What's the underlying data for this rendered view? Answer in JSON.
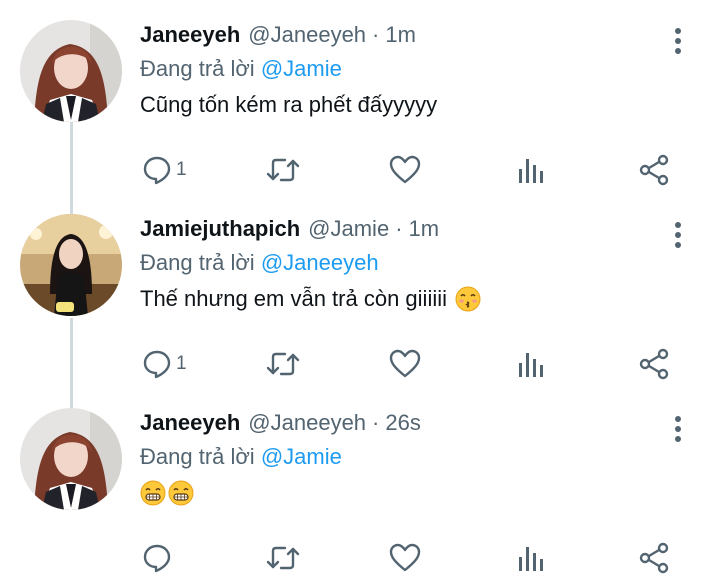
{
  "colors": {
    "accent": "#1d9bf0",
    "muted": "#536471",
    "text": "#0f1419",
    "thread_line": "#cfd9de"
  },
  "replying_prefix": "Đang trả lời",
  "tweets": [
    {
      "name": "Janeeyeh",
      "handle": "@Janeeyeh",
      "separator": "·",
      "time": "1m",
      "reply_to": "@Jamie",
      "text": "Cũng tốn kém ra phết đấyyyyy",
      "emojis": [],
      "reply_count": "1",
      "icons": [
        "reply-icon",
        "retweet-icon",
        "like-icon",
        "views-icon",
        "share-icon",
        "more-icon"
      ]
    },
    {
      "name": "Jamiejuthapich",
      "handle": "@Jamie",
      "separator": "·",
      "time": "1m",
      "reply_to": "@Janeeyeh",
      "text": "Thế nhưng em vẫn trả còn giiiiii",
      "emojis": [
        "kissing-face-emoji"
      ],
      "reply_count": "1",
      "icons": [
        "reply-icon",
        "retweet-icon",
        "like-icon",
        "views-icon",
        "share-icon",
        "more-icon"
      ]
    },
    {
      "name": "Janeeyeh",
      "handle": "@Janeeyeh",
      "separator": "·",
      "time": "26s",
      "reply_to": "@Jamie",
      "text": "",
      "emojis": [
        "grinning-face-emoji",
        "grinning-face-emoji"
      ],
      "reply_count": "",
      "icons": [
        "reply-icon",
        "retweet-icon",
        "like-icon",
        "views-icon",
        "share-icon",
        "more-icon"
      ]
    }
  ]
}
